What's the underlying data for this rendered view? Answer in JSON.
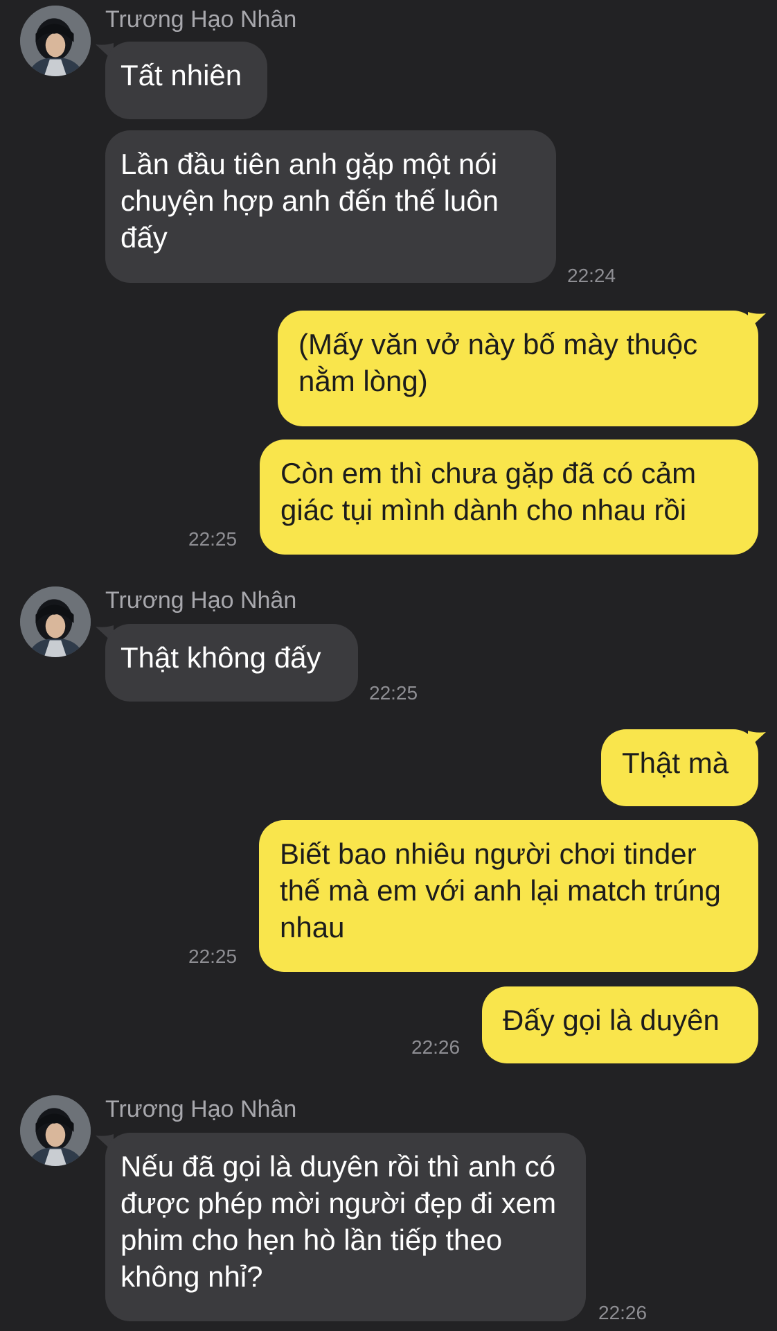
{
  "colors": {
    "background": "#222224",
    "incoming_bubble": "#3b3b3e",
    "outgoing_bubble": "#f9e54c",
    "timestamp": "#8e8e93",
    "sender_name": "#a8a8ad"
  },
  "contact": {
    "name": "Trương Hạo Nhân",
    "avatar_icon": "profile-photo"
  },
  "messages": [
    {
      "direction": "in",
      "text": "Tất nhiên"
    },
    {
      "direction": "in",
      "text": "Lần đầu tiên anh gặp một nói chuyện hợp anh đến thế luôn đấy",
      "time": "22:24"
    },
    {
      "direction": "out",
      "text": "(Mấy văn vở này bố mày thuộc nằm lòng)"
    },
    {
      "direction": "out",
      "text": "Còn em thì chưa gặp đã có cảm giác tụi mình dành cho nhau rồi",
      "time": "22:25"
    },
    {
      "direction": "in",
      "text": "Thật không đấy",
      "time": "22:25"
    },
    {
      "direction": "out",
      "text": "Thật mà"
    },
    {
      "direction": "out",
      "text": "Biết bao nhiêu người chơi tinder thế mà em với anh lại match trúng nhau",
      "time": "22:25"
    },
    {
      "direction": "out",
      "text": "Đấy gọi là duyên",
      "time": "22:26"
    },
    {
      "direction": "in",
      "text": "Nếu đã gọi là duyên rồi thì anh có được phép mời người đẹp đi xem phim cho hẹn hò lần tiếp theo không nhỉ?",
      "time": "22:26"
    }
  ]
}
